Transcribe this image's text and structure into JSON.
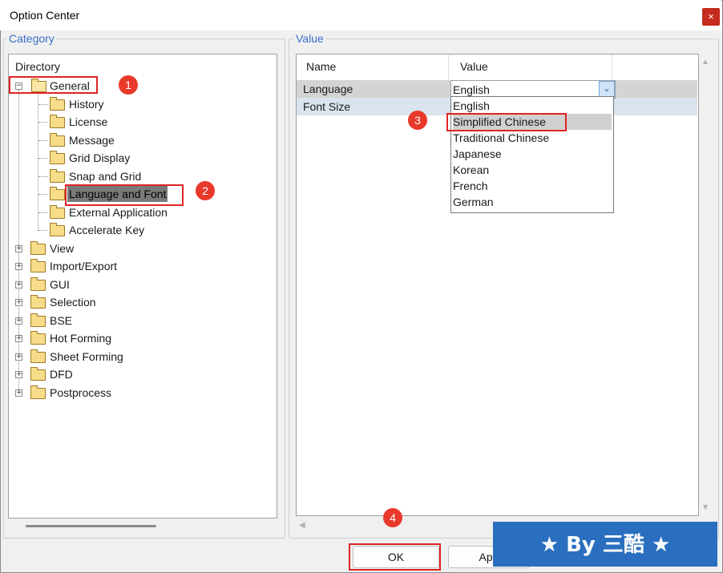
{
  "window": {
    "title": "Option Center",
    "close_glyph": "×"
  },
  "category": {
    "label": "Category",
    "directory_header": "Directory",
    "general": "General",
    "general_children": [
      "History",
      "License",
      "Message",
      "Grid Display",
      "Snap and Grid",
      "Language and Font",
      "External Application",
      "Accelerate Key"
    ],
    "top_nodes": [
      "View",
      "Import/Export",
      "GUI",
      "Selection",
      "BSE",
      "Hot Forming",
      "Sheet Forming",
      "DFD",
      "Postprocess"
    ],
    "selected": "Language and Font"
  },
  "value": {
    "label": "Value",
    "col_name": "Name",
    "col_value": "Value",
    "rows": [
      {
        "name": "Language",
        "value": "English"
      },
      {
        "name": "Font Size",
        "value": ""
      }
    ],
    "dropdown_options": [
      "English",
      "Simplified Chinese",
      "Traditional Chinese",
      "Japanese",
      "Korean",
      "French",
      "German"
    ],
    "highlighted_option": "Simplified Chinese"
  },
  "buttons": {
    "ok": "OK",
    "apply": "App"
  },
  "annotations": [
    "1",
    "2",
    "3",
    "4"
  ],
  "watermark": "★ By 三酷 ★",
  "colors": {
    "annotation_red": "#e02424",
    "badge_red": "#e8392b",
    "watermark_blue": "#2a6fbf",
    "label_blue": "#3a6fc9"
  }
}
